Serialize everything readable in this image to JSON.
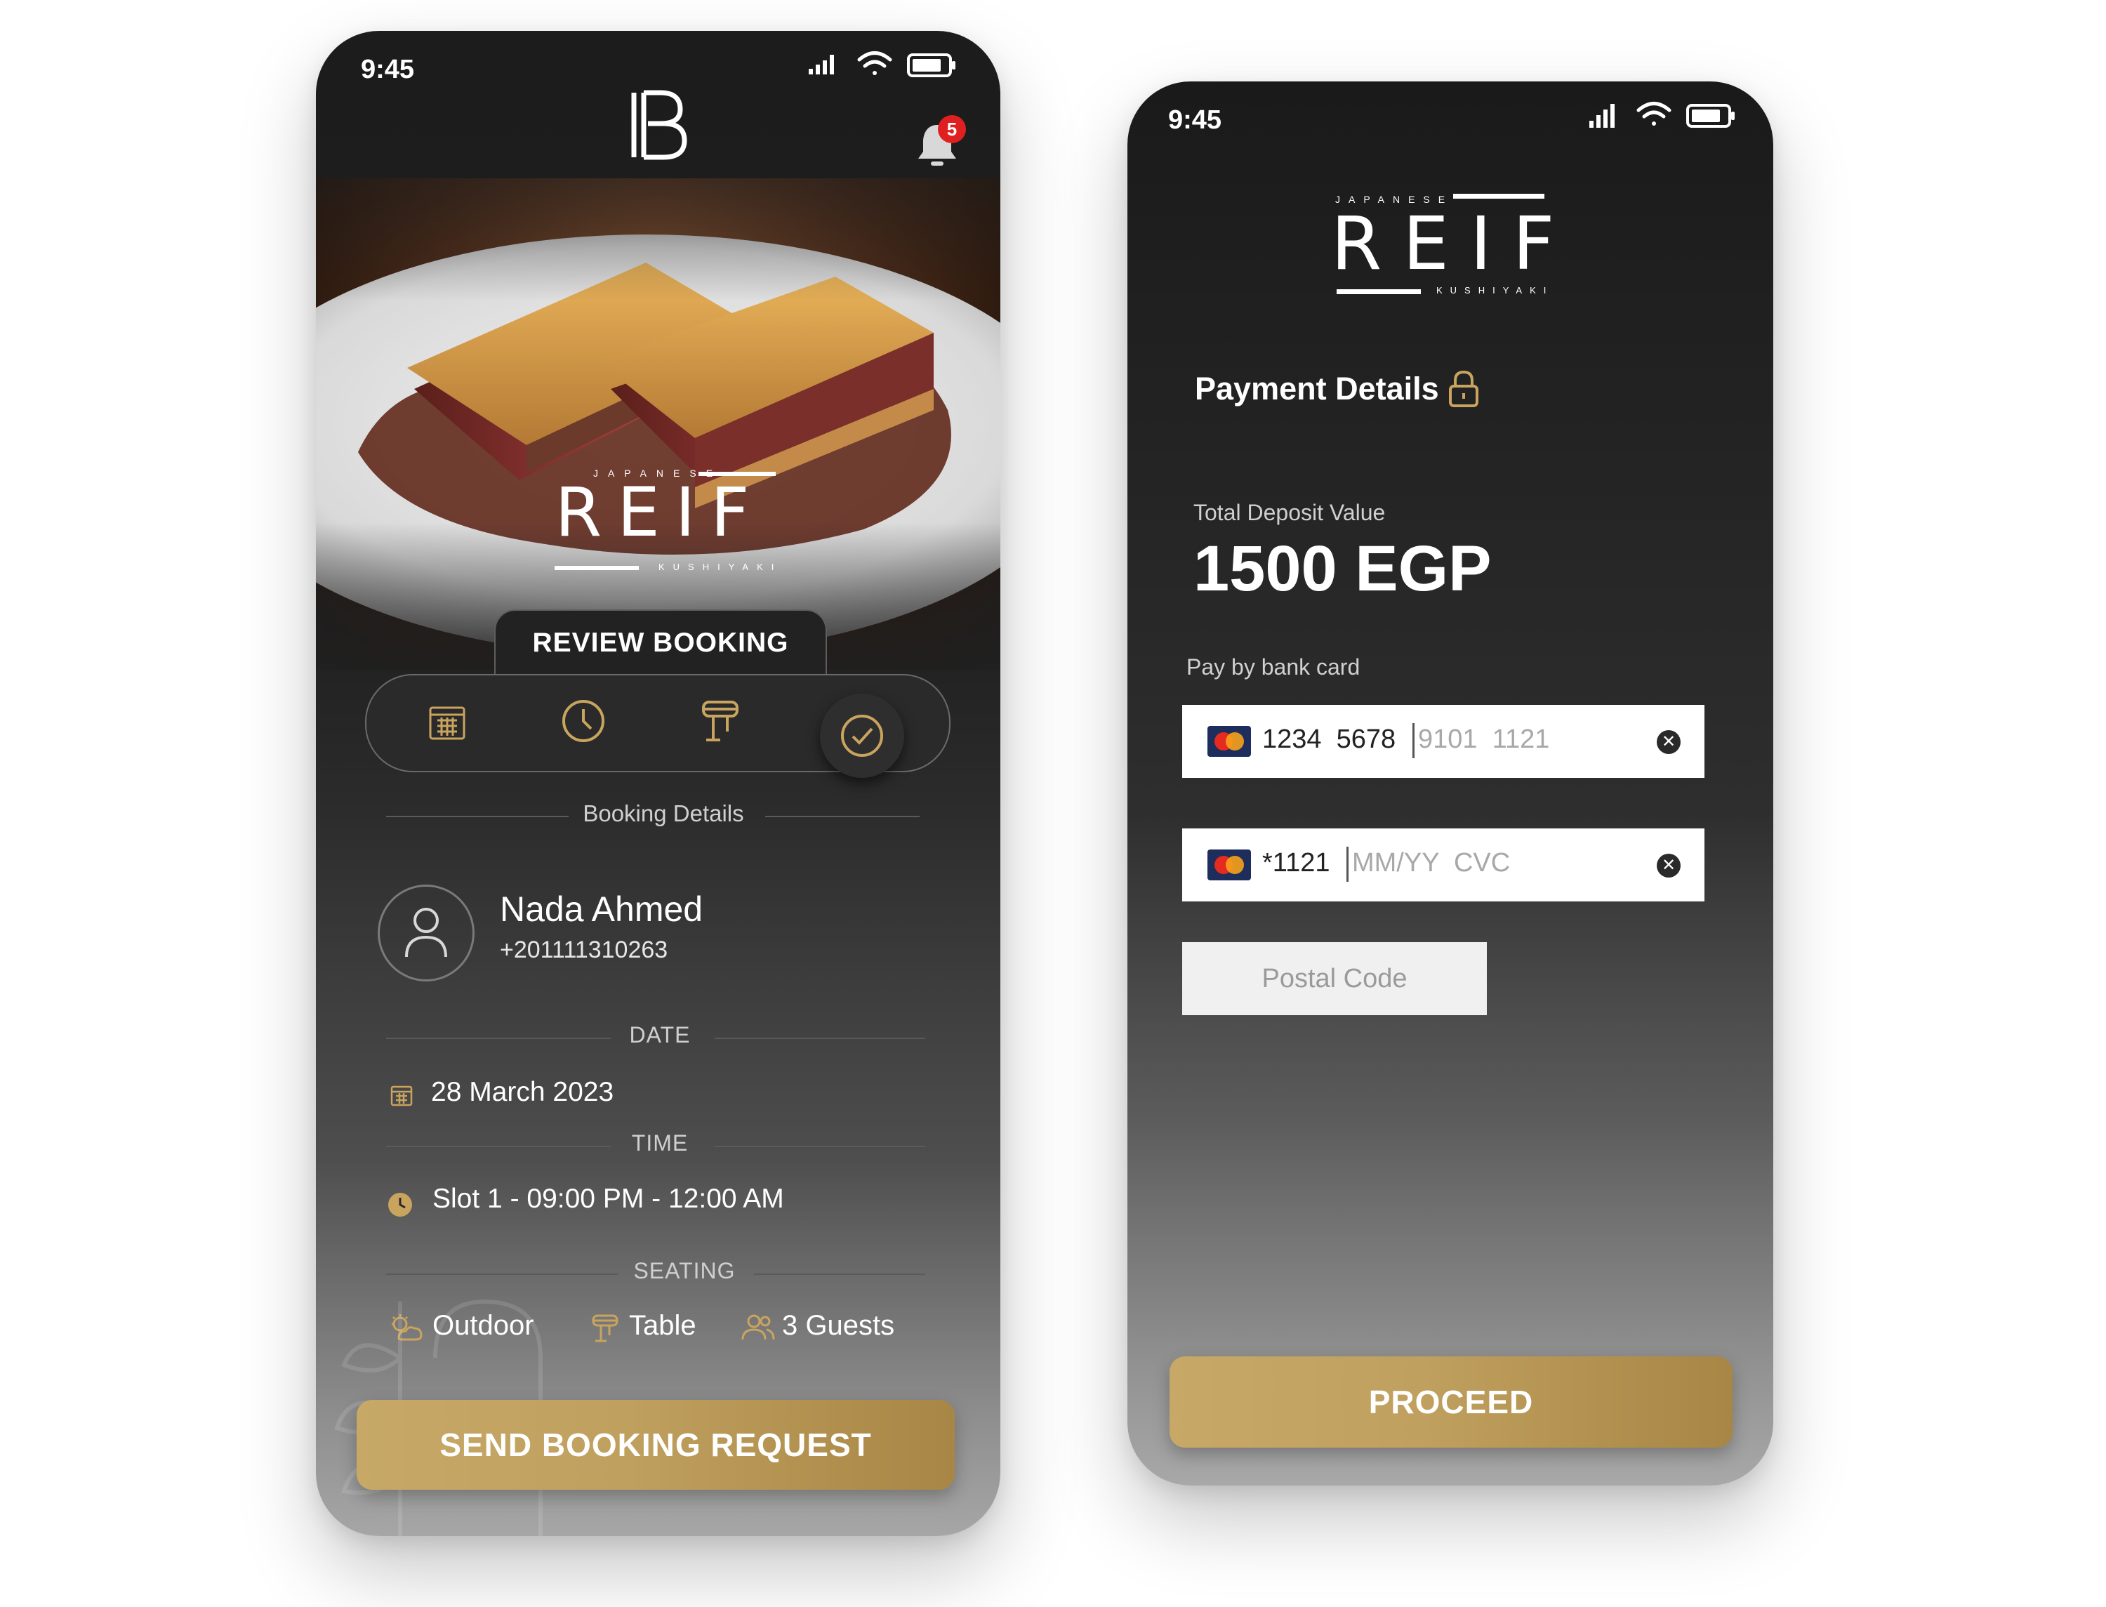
{
  "booking_screen": {
    "status_time": "9:45",
    "notification_count": "5",
    "hero_brand": {
      "top": "JAPANESE",
      "name": "REIF",
      "bottom": "KUSHIYAKI"
    },
    "tab_label": "REVIEW BOOKING",
    "steps": [
      "calendar-step",
      "time-step",
      "table-step",
      "confirm-step"
    ],
    "section_title": "Booking Details",
    "customer": {
      "name": "Nada Ahmed",
      "phone": "+201111310263"
    },
    "date_label": "DATE",
    "date_value": "28 March 2023",
    "time_label": "TIME",
    "time_value": "Slot 1 - 09:00 PM - 12:00 AM",
    "seating_label": "SEATING",
    "seating": {
      "area": "Outdoor",
      "type": "Table",
      "guests": "3 Guests"
    },
    "submit_label": "SEND BOOKING REQUEST"
  },
  "payment_screen": {
    "status_time": "9:45",
    "brand": {
      "top": "JAPANESE",
      "name": "REIF",
      "bottom": "KUSHIYAKI"
    },
    "title": "Payment Details",
    "deposit_label": "Total Deposit Value",
    "deposit_value": "1500 EGP",
    "pay_label": "Pay by bank card",
    "card_number_filled": "1234  5678",
    "card_number_placeholder": "9101  1121",
    "card_last4": "*1121",
    "expiry_placeholder": "MM/YY  CVC",
    "postal_placeholder": "Postal Code",
    "proceed_label": "PROCEED"
  },
  "colors": {
    "accent_gold": "#c9a45e",
    "badge_red": "#e02020"
  }
}
